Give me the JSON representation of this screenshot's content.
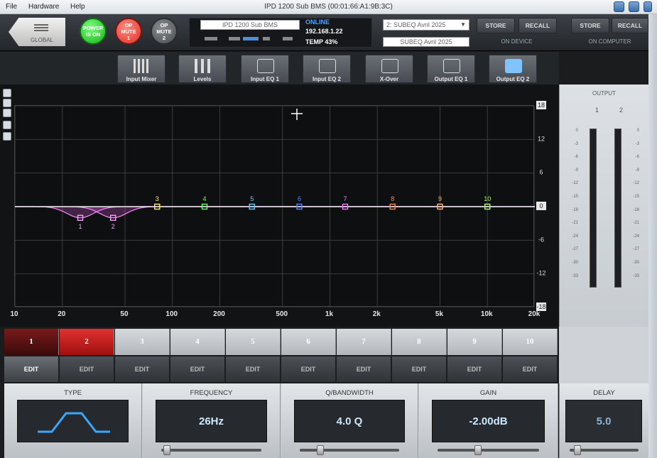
{
  "window": {
    "title": "IPD 1200 Sub BMS (00:01:66:A1:9B:3C)",
    "menu": [
      "File",
      "Hardware",
      "Help"
    ]
  },
  "toolbar": {
    "global_label": "GLOBAL",
    "power": {
      "line1": "POWER",
      "line2": "IS ON"
    },
    "op_mute_1": {
      "line1": "OP",
      "line2": "MUTE",
      "line3": "1"
    },
    "op_mute_2": {
      "line1": "OP",
      "line2": "MUTE",
      "line3": "2"
    },
    "device_name": "IPD 1200 Sub BMS",
    "status": "ONLINE",
    "ip": "192.168.1.22",
    "temp_label": "TEMP",
    "temp_value": "43%",
    "preset_selected": "2: SUBEQ Avril 2025",
    "preset_name": "SUBEQ Avril 2025",
    "store_device": "STORE",
    "recall_device": "RECALL",
    "on_device": "ON DEVICE",
    "store_computer": "STORE",
    "recall_computer": "RECALL",
    "on_computer": "ON COMPUTER"
  },
  "tabs": [
    {
      "label": "Input Mixer",
      "icon": "mixer-icon"
    },
    {
      "label": "Levels",
      "icon": "levels-icon"
    },
    {
      "label": "Input EQ 1",
      "icon": "eq-icon"
    },
    {
      "label": "Input EQ 2",
      "icon": "eq-icon"
    },
    {
      "label": "X-Over",
      "icon": "crossover-icon"
    },
    {
      "label": "Output EQ 1",
      "icon": "eq-icon"
    },
    {
      "label": "Output EQ 2",
      "icon": "eq-icon",
      "active": true
    }
  ],
  "graph": {
    "y_ticks_right": [
      "18",
      "12",
      "6",
      "0",
      "-6",
      "-12",
      "-18"
    ],
    "x_ticks": [
      "10",
      "20",
      "50",
      "100",
      "200",
      "500",
      "1k",
      "2k",
      "5k",
      "10k",
      "20k"
    ],
    "x_tick_values": [
      10,
      20,
      50,
      100,
      200,
      500,
      1000,
      2000,
      5000,
      10000,
      20000
    ],
    "y_tick_values": [
      18,
      12,
      6,
      0,
      -6,
      -12,
      -18
    ],
    "filter_points": [
      {
        "label": "1",
        "freq": 26,
        "gain": -2,
        "color": "#ff9aff"
      },
      {
        "label": "2",
        "freq": 42,
        "gain": -2,
        "color": "#ff9aff"
      },
      {
        "label": "3",
        "freq": 80,
        "gain": 0,
        "color": "#ffee55"
      },
      {
        "label": "4",
        "freq": 160,
        "gain": 0,
        "color": "#66ff66"
      },
      {
        "label": "5",
        "freq": 320,
        "gain": 0,
        "color": "#66ccff"
      },
      {
        "label": "6",
        "freq": 640,
        "gain": 0,
        "color": "#5588ff"
      },
      {
        "label": "7",
        "freq": 1250,
        "gain": 0,
        "color": "#ff77ff"
      },
      {
        "label": "8",
        "freq": 2500,
        "gain": 0,
        "color": "#ff8844"
      },
      {
        "label": "9",
        "freq": 5000,
        "gain": 0,
        "color": "#ffbb77"
      },
      {
        "label": "10",
        "freq": 10000,
        "gain": 0,
        "color": "#aaff66"
      }
    ]
  },
  "bands": {
    "numbers": [
      "1",
      "2",
      "3",
      "4",
      "5",
      "6",
      "7",
      "8",
      "9",
      "10"
    ],
    "edit_label": "EDIT",
    "selected": "2"
  },
  "params": {
    "type_label": "TYPE",
    "freq_label": "FREQUENCY",
    "freq_value": "26Hz",
    "q_label": "Q/BANDWIDTH",
    "q_value": "4.0 Q",
    "gain_label": "GAIN",
    "gain_value": "-2.00dB",
    "delay_label": "DELAY",
    "delay_value": "5.0"
  },
  "output": {
    "title": "OUTPUT",
    "ch1": "1",
    "ch2": "2",
    "scale": [
      "0",
      "-3",
      "-6",
      "-9",
      "-12",
      "-15",
      "-18",
      "-21",
      "-24",
      "-27",
      "-30",
      "-33"
    ]
  }
}
